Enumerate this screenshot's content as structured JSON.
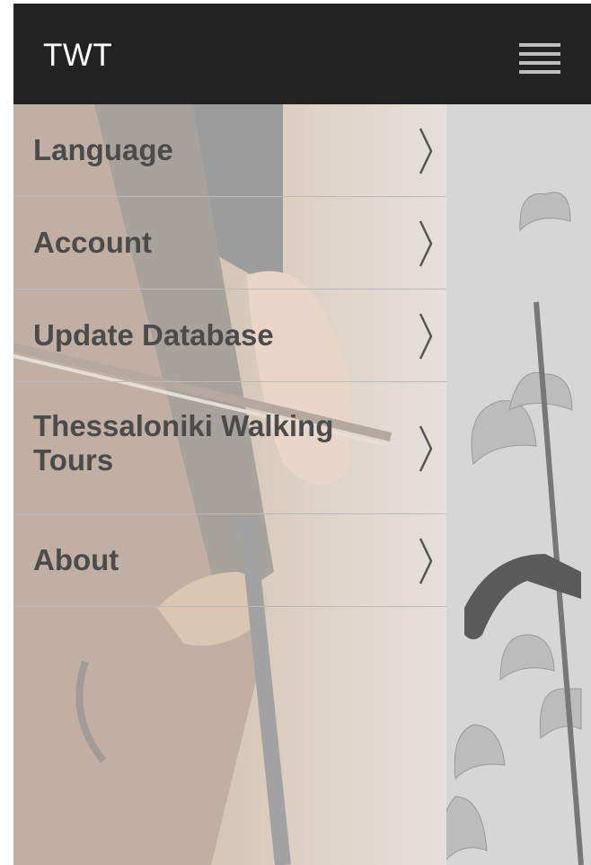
{
  "app_bar": {
    "title": "TWT",
    "menu_icon": "hamburger-menu-icon"
  },
  "drawer": {
    "items": [
      {
        "label": "Language",
        "icon": "chevron-right-icon"
      },
      {
        "label": "Account",
        "icon": "chevron-right-icon"
      },
      {
        "label": "Update Database",
        "icon": "chevron-right-icon"
      },
      {
        "label": "Thessaloniki Walking Tours",
        "icon": "chevron-right-icon"
      },
      {
        "label": "About",
        "icon": "chevron-right-icon"
      }
    ]
  },
  "colors": {
    "app_bar_bg": "#222222",
    "menu_text": "#4b4b4b",
    "divider": "#b9b9b9"
  }
}
